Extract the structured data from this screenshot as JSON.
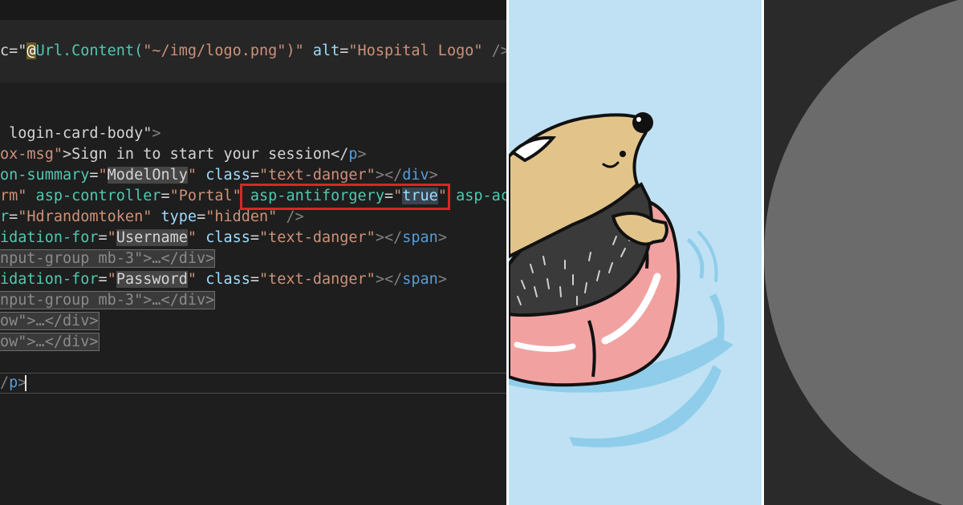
{
  "editor": {
    "lines": {
      "l1": {
        "a": "c=\"",
        "at": "@",
        "b": "Url.Content(",
        "c": "\"~/img/logo.png\"",
        "d": ")\"",
        "e": " alt",
        "f": "=",
        "g": "\"Hospital Logo\"",
        "h": " />"
      },
      "l2": {
        "a": " login-card-body\"",
        "b": ">"
      },
      "l3": {
        "a": "ox-msg\"",
        "b": ">Sign in to start your session</",
        "c": "p",
        "d": ">"
      },
      "l4": {
        "a": "on-summary",
        "b": "=",
        "c": "\"",
        "c2": "ModelOnly",
        "c3": "\"",
        "d": " class",
        "e": "=",
        "f": "\"text-danger\"",
        "g": "></",
        "h": "div",
        "i": ">"
      },
      "l5": {
        "a": "rm\"",
        "b": " asp-controller",
        "c": "=",
        "d": "\"Portal\"",
        "e": " asp-antiforgery",
        "f": "=",
        "g": "\"",
        "g2": "true",
        "g3": "\"",
        "h": " asp-ac"
      },
      "l6": {
        "a": "r",
        "b": "=",
        "c": "\"Hdrandomtoken\"",
        "d": " type",
        "e": "=",
        "f": "\"hidden\"",
        "g": " />"
      },
      "l7": {
        "a": "idation-for",
        "b": "=",
        "c": "\"",
        "c2": "Username",
        "c3": "\"",
        "d": " class",
        "e": "=",
        "f": "\"text-danger\"",
        "g": "></",
        "h": "span",
        "i": ">"
      },
      "l8": "nput-group mb-3\">…</div>",
      "l9": {
        "a": "idation-for",
        "b": "=",
        "c": "\"",
        "c2": "Password",
        "c3": "\"",
        "d": " class",
        "e": "=",
        "f": "\"text-danger\"",
        "g": "></",
        "h": "span",
        "i": ">"
      },
      "l10": "nput-group mb-3\">…</div>",
      "l11": "ow\">…</div>",
      "l12": "ow\">…</div>",
      "l13": {
        "a": "/",
        "b": "p",
        "c": ">"
      }
    },
    "colors": {
      "background": "#1e1e1e",
      "string": "#ce9178",
      "attribute": "#9cdcfe",
      "highlight_box": "#d9262b"
    }
  },
  "illustration": {
    "subject": "hedgehog-on-swim-ring",
    "background": "#bfe1f3"
  },
  "right_panel": {
    "shape": "grey-circle",
    "background": "#2a2a2a",
    "circle_color": "#6b6b6b"
  }
}
